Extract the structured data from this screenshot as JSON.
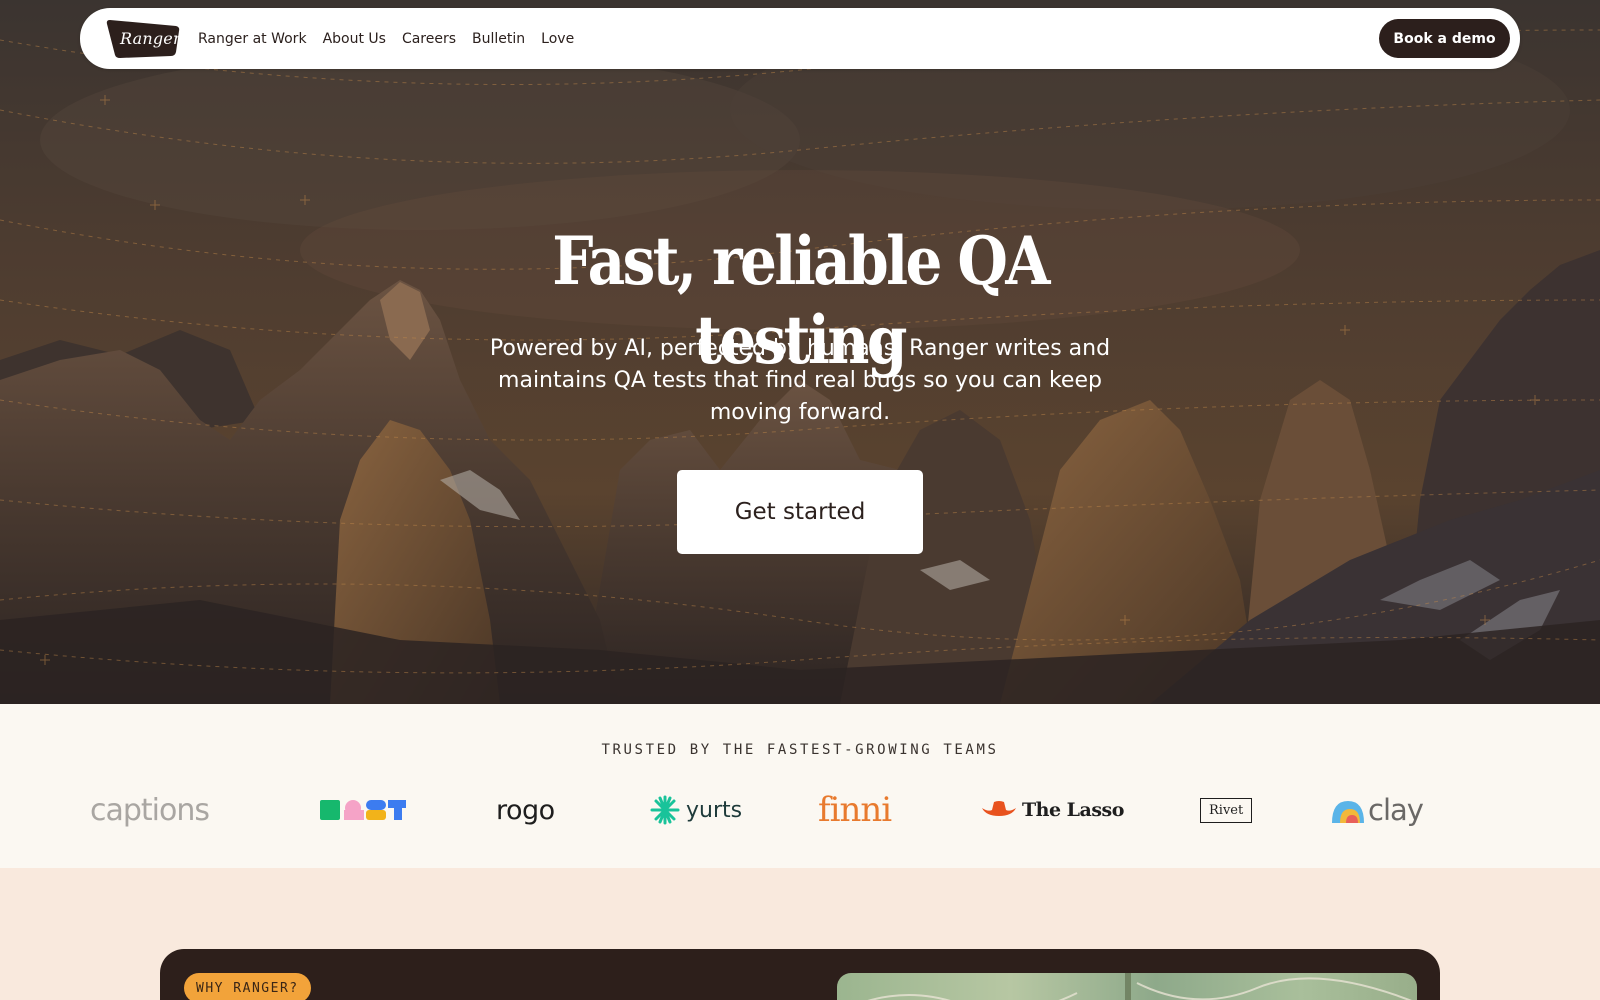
{
  "nav": {
    "logo_text": "Ranger",
    "links": [
      "Ranger at Work",
      "About Us",
      "Careers",
      "Bulletin",
      "Love"
    ],
    "cta_label": "Book a demo"
  },
  "hero": {
    "title": "Fast, reliable QA testing",
    "subtitle": "Powered by AI, perfected by humans. Ranger writes and maintains QA tests that find real bugs so you can keep moving forward.",
    "cta_label": "Get started"
  },
  "trusted": {
    "label": "TRUSTED BY THE FASTEST-GROWING TEAMS",
    "logos": [
      "captions",
      "DUST",
      "rogo",
      "yurts",
      "finni",
      "The Lasso",
      "Rivet",
      "clay"
    ]
  },
  "why": {
    "badge": "WHY RANGER?"
  },
  "colors": {
    "brand_dark": "#2c1f1c",
    "accent_orange": "#f2a33a",
    "cream": "#fbf8f2",
    "peach": "#f9e9dd"
  }
}
